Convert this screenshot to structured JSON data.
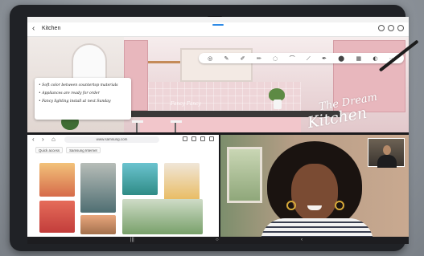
{
  "note": {
    "title": "Kitchen",
    "back_icon": "arrow-left-icon",
    "header_icons": [
      "layout-icon",
      "pen-icon",
      "more-icon"
    ],
    "toolbar": [
      "◎",
      "✎",
      "✐",
      "✏",
      "◌",
      "⌒",
      "⟋",
      "✒",
      "⬤",
      "▦",
      "◐",
      "⋯"
    ],
    "card_lines": [
      "• Soft color between countertop materials",
      "• Appliances are ready for order",
      "• Fancy lighting install at next Sunday"
    ],
    "watermark": "Fancy Fancy",
    "handwriting_1": "The Dream",
    "handwriting_2": "Kitchen"
  },
  "browser": {
    "url": "www.samsung.com",
    "tabs": [
      "Quick access",
      "Samsung Internet"
    ]
  },
  "colors": {
    "accent": "#2f8be6",
    "kitchen_pink": "#f2c6cb"
  }
}
